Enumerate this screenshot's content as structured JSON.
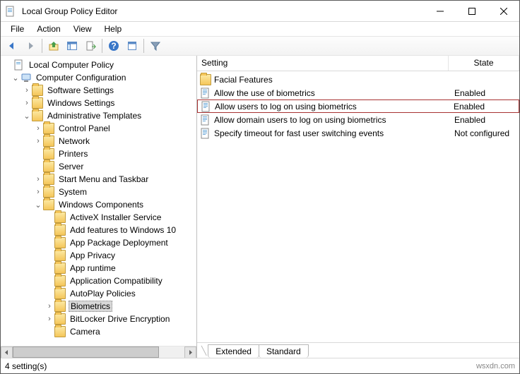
{
  "window": {
    "title": "Local Group Policy Editor"
  },
  "menubar": [
    "File",
    "Action",
    "View",
    "Help"
  ],
  "tree": {
    "root": "Local Computer Policy",
    "comp_cfg": "Computer Configuration",
    "software": "Software Settings",
    "windows": "Windows Settings",
    "admin": "Administrative Templates",
    "cp": "Control Panel",
    "network": "Network",
    "printers": "Printers",
    "server": "Server",
    "start": "Start Menu and Taskbar",
    "system": "System",
    "wincomp": "Windows Components",
    "wc": {
      "0": "ActiveX Installer Service",
      "1": "Add features to Windows 10",
      "2": "App Package Deployment",
      "3": "App Privacy",
      "4": "App runtime",
      "5": "Application Compatibility",
      "6": "AutoPlay Policies",
      "7": "Biometrics",
      "8": "BitLocker Drive Encryption",
      "9": "Camera"
    }
  },
  "columns": {
    "setting": "Setting",
    "state": "State"
  },
  "rows": [
    {
      "icon": "folder",
      "setting": "Facial Features",
      "state": ""
    },
    {
      "icon": "policy",
      "setting": "Allow the use of biometrics",
      "state": "Enabled"
    },
    {
      "icon": "policy",
      "setting": "Allow users to log on using biometrics",
      "state": "Enabled",
      "highlight": true
    },
    {
      "icon": "policy",
      "setting": "Allow domain users to log on using biometrics",
      "state": "Enabled"
    },
    {
      "icon": "policy",
      "setting": "Specify timeout for fast user switching events",
      "state": "Not configured"
    }
  ],
  "tabs": {
    "extended": "Extended",
    "standard": "Standard"
  },
  "status": "4 setting(s)",
  "watermark": "wsxdn.com"
}
